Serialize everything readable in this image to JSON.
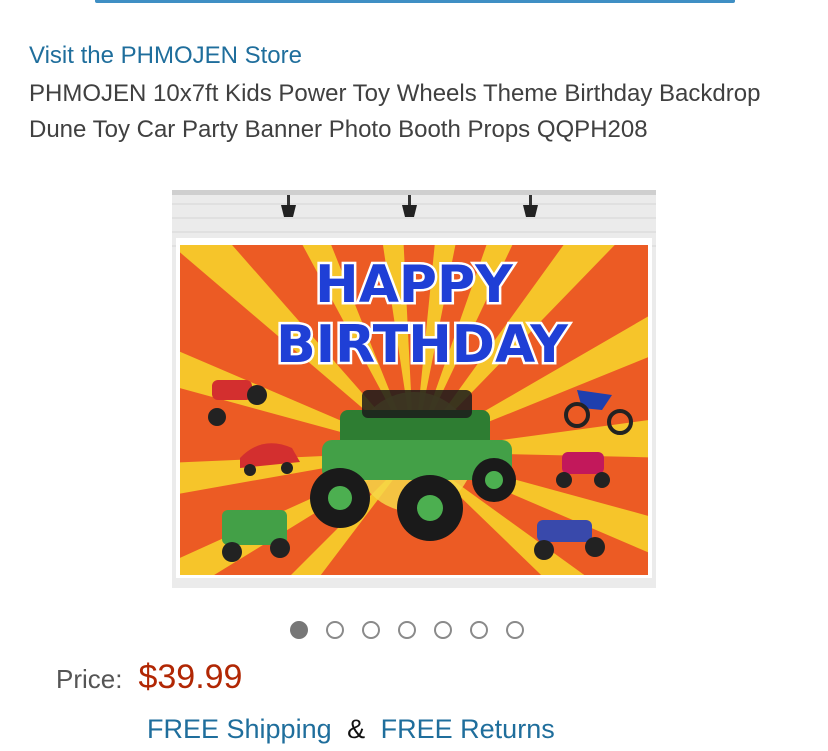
{
  "store": {
    "link_label": "Visit the PHMOJEN Store"
  },
  "product": {
    "title": "PHMOJEN 10x7ft Kids Power Toy Wheels Theme Birthday Backdrop Dune Toy Car Party Banner Photo Booth Props QQPH208",
    "image_text_line1": "HAPPY",
    "image_text_line2": "BIRTHDAY"
  },
  "carousel": {
    "count": 7,
    "active_index": 0
  },
  "price": {
    "label": "Price:",
    "value": "$39.99"
  },
  "shipping": {
    "free_shipping": "FREE Shipping",
    "separator": "&",
    "free_returns": "FREE Returns"
  },
  "colors": {
    "link": "#1f6e9c",
    "price": "#b12704",
    "banner_orange": "#ec5b24",
    "banner_yellow": "#f6c52a",
    "banner_text": "#1f3fd6"
  }
}
